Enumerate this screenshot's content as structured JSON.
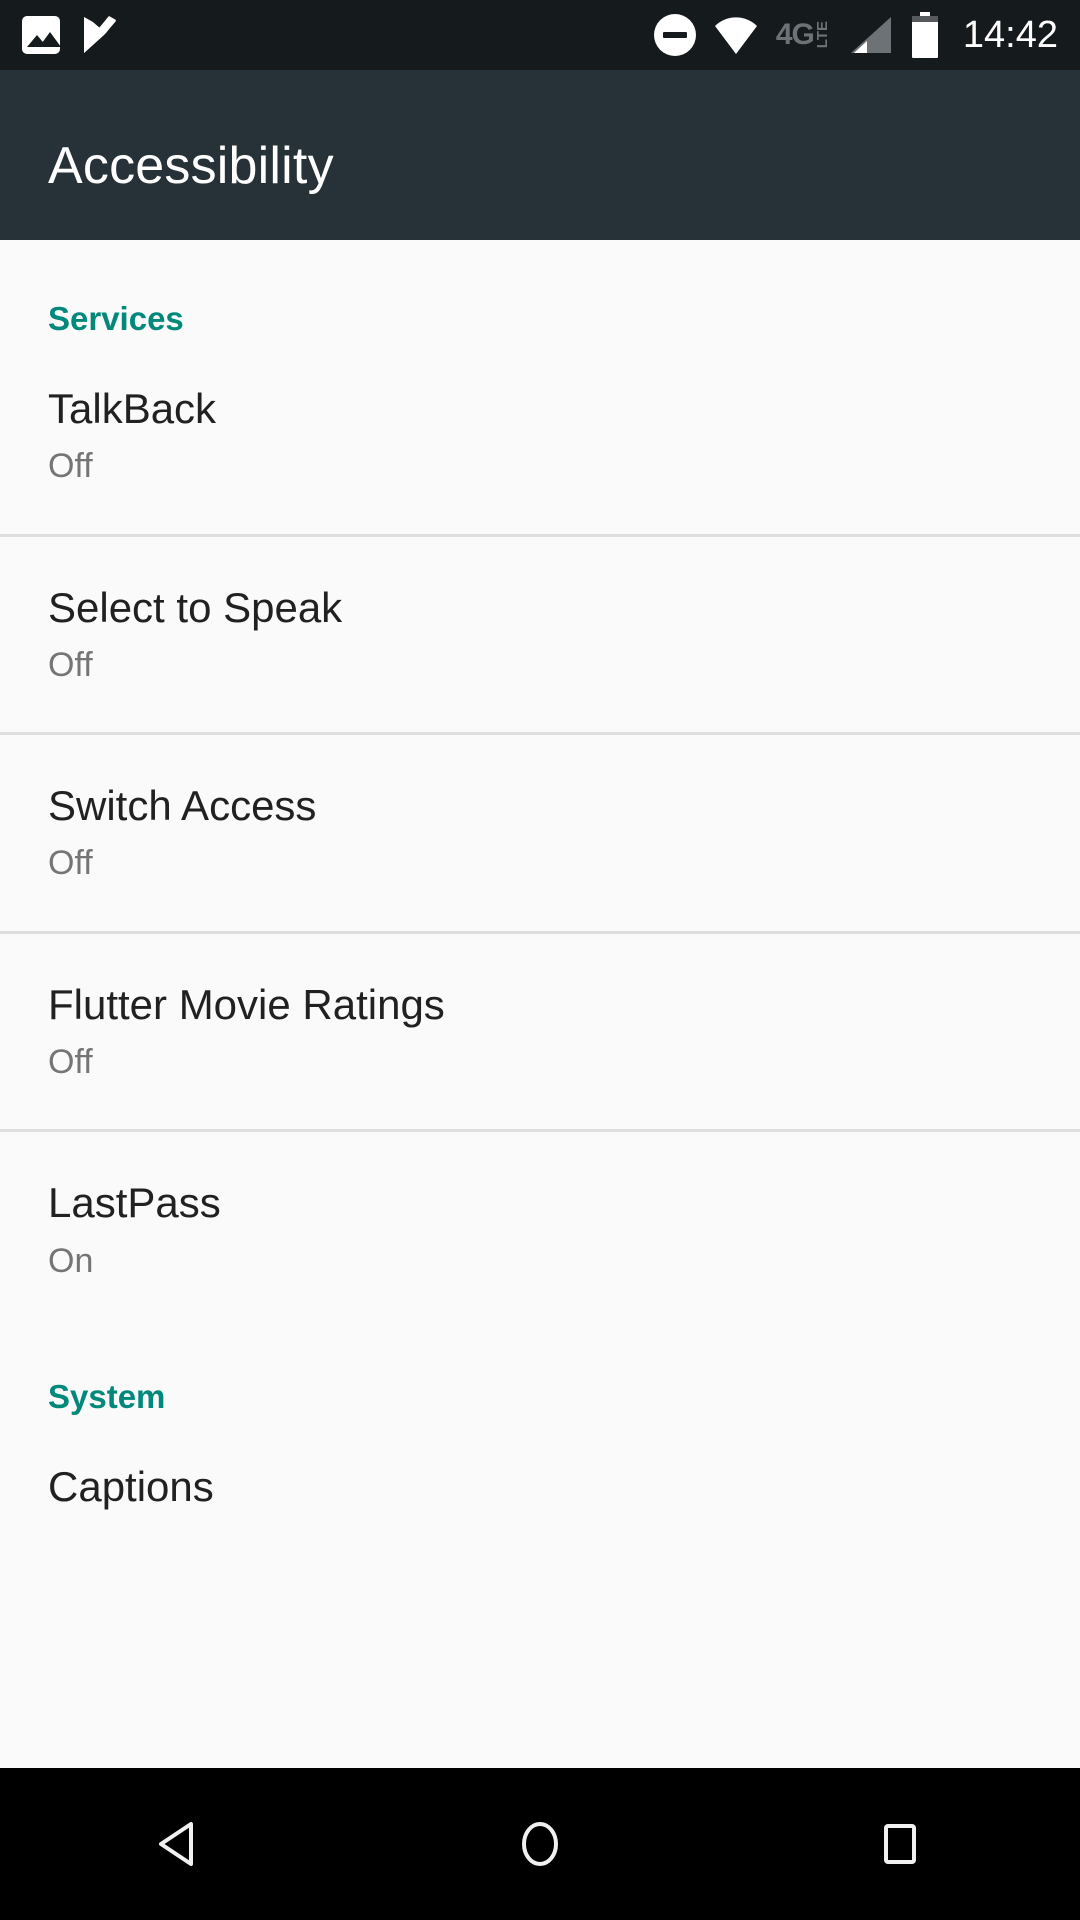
{
  "status_bar": {
    "background": "#151a1d",
    "left_icons": [
      {
        "name": "screenshot-icon",
        "label": "screenshot"
      },
      {
        "name": "checkmark-flag-icon",
        "label": "tick"
      }
    ],
    "right_icons": [
      {
        "name": "do-not-disturb-icon",
        "label": "do not disturb"
      },
      {
        "name": "wifi-icon",
        "label": "wifi"
      },
      {
        "name": "network-type-label",
        "label": "4G",
        "superscript": "LTE"
      },
      {
        "name": "cellular-signal-icon",
        "label": "signal"
      },
      {
        "name": "battery-icon",
        "label": "battery"
      }
    ],
    "network_type": "4G",
    "network_suffix": "LTE",
    "time": "14:42"
  },
  "app_bar": {
    "title": "Accessibility",
    "background": "#263238",
    "title_color": "#ffffff"
  },
  "theme": {
    "accent": "#00897b",
    "page_background": "#fafafa",
    "primary_text": "#212121",
    "secondary_text": "#757575",
    "divider": "#dedede"
  },
  "sections": [
    {
      "header": "Services",
      "items": [
        {
          "title": "TalkBack",
          "status": "Off",
          "divider_below": true
        },
        {
          "title": "Select to Speak",
          "status": "Off",
          "divider_below": true
        },
        {
          "title": "Switch Access",
          "status": "Off",
          "divider_below": true
        },
        {
          "title": "Flutter Movie Ratings",
          "status": "Off",
          "divider_below": true
        },
        {
          "title": "LastPass",
          "status": "On",
          "divider_below": false
        }
      ]
    },
    {
      "header": "System",
      "items": [
        {
          "title": "Captions",
          "status": "",
          "divider_below": false
        }
      ]
    }
  ],
  "nav_bar": {
    "background": "#000000",
    "buttons": [
      {
        "name": "back-button",
        "label": "Back"
      },
      {
        "name": "home-button",
        "label": "Home"
      },
      {
        "name": "recents-button",
        "label": "Recents"
      }
    ]
  }
}
